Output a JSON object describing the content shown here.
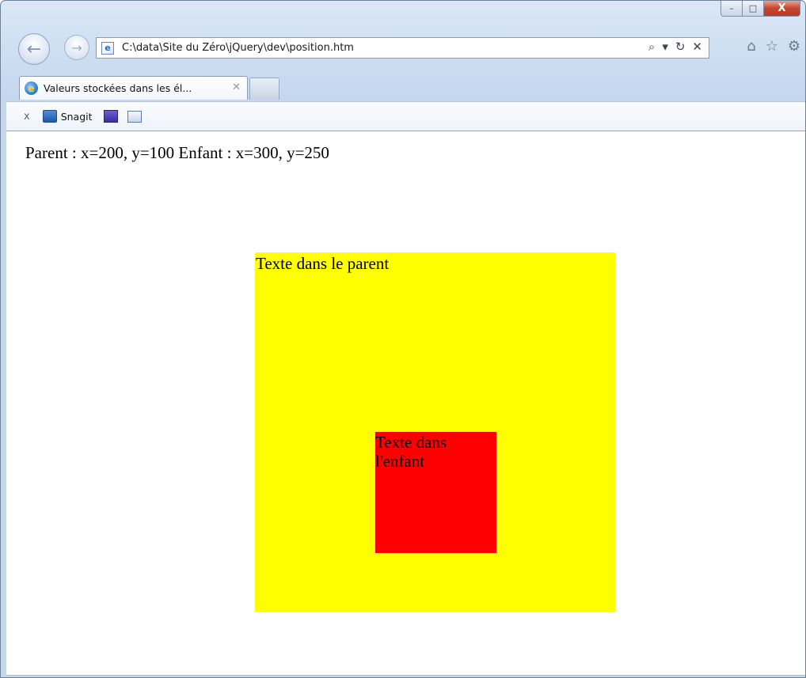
{
  "browser": {
    "window_buttons": {
      "minimize": "–",
      "maximize": "□",
      "close": "X"
    },
    "nav": {
      "back_icon": "back-arrow-icon",
      "forward_icon": "forward-arrow-icon",
      "back_glyph": "←",
      "forward_glyph": "→"
    },
    "address_bar": {
      "url": "C:\\data\\Site du Zéro\\jQuery\\dev\\position.htm",
      "page_icon_glyph": "e",
      "search_glyph": "⌕",
      "dropdown_glyph": "▾",
      "refresh_glyph": "↻",
      "stop_glyph": "✕"
    },
    "toolbar_icons": {
      "home_glyph": "⌂",
      "favorites_glyph": "☆",
      "tools_glyph": "⚙"
    },
    "tabs": [
      {
        "title": "Valeurs stockées dans les él...",
        "close_glyph": "✕",
        "favicon_glyph": "e"
      }
    ],
    "favorites_bar": {
      "close_glyph": "x",
      "snagit_label": "Snagit"
    }
  },
  "page": {
    "status_text": "Parent : x=200, y=100 Enfant : x=300, y=250",
    "parent": {
      "text": "Texte dans le parent",
      "color": "#ffff00"
    },
    "child": {
      "text": "Texte dans l'enfant",
      "color": "#ff0000"
    }
  }
}
